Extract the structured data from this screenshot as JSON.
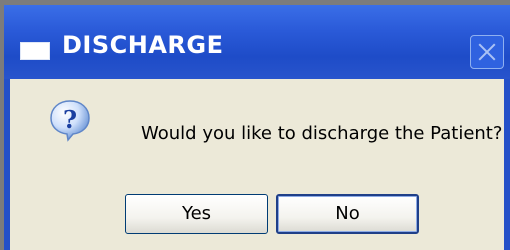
{
  "dialog": {
    "title": "DISCHARGE",
    "message": "Would you like to discharge the Patient?",
    "icon": "question-icon",
    "buttons": {
      "yes_label": "Yes",
      "no_label": "No"
    }
  },
  "colors": {
    "titlebar": "#2450c8",
    "dialog_body": "#ece9d8",
    "button_border": "#003c74"
  }
}
